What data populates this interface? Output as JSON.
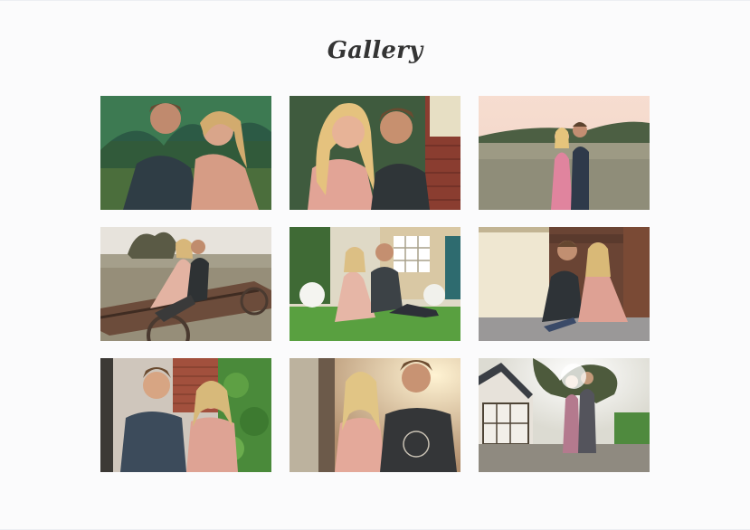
{
  "gallery": {
    "title": "Gallery",
    "photos": [
      {
        "scene": "couple-lying-in-grass"
      },
      {
        "scene": "couple-close-up-by-brick-wall"
      },
      {
        "scene": "couple-standing-in-field-at-sunset"
      },
      {
        "scene": "couple-sitting-on-old-wagon"
      },
      {
        "scene": "couple-sitting-on-lawn-by-house"
      },
      {
        "scene": "couple-sitting-by-barn-door"
      },
      {
        "scene": "couple-standing-by-ivy-wall"
      },
      {
        "scene": "couple-portrait-in-sunlight"
      },
      {
        "scene": "couple-under-tree-backlit"
      }
    ]
  }
}
